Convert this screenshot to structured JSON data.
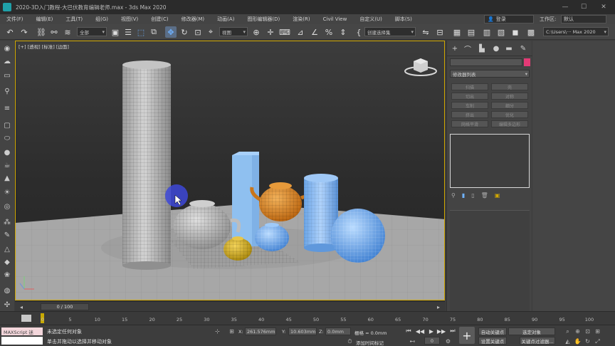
{
  "titlebar": {
    "title": "2020-3D入门教程-大巴伏教育编辑老师.max - 3ds Max 2020",
    "minimize": "—",
    "maximize": "☐",
    "close": "✕"
  },
  "menubar": {
    "items": [
      "文件(F)",
      "编辑(E)",
      "工具(T)",
      "组(G)",
      "视图(V)",
      "创建(C)",
      "修改器(M)",
      "动画(A)",
      "图形编辑器(D)",
      "渲染(R)",
      "Civil View",
      "自定义(U)",
      "脚本(S)"
    ],
    "login": "登录",
    "workspace_label": "工作区:",
    "workspace_value": "默认"
  },
  "toolbar": {
    "selection_filter": "全部",
    "ref_coord": "视图",
    "named_selection": "创建选择集",
    "project_path": "C:\\Users\\··· Max 2020"
  },
  "viewport": {
    "label": "[+] [透视] [标准] [边面]"
  },
  "command_panel": {
    "modifier_list": "修改器列表",
    "buttons": [
      "扫描",
      "壳",
      "切出",
      "对称",
      "车削",
      "细分",
      "挤出",
      "优化",
      "网格平滑",
      "编辑多边形"
    ]
  },
  "timeline": {
    "frame_counter": "0 / 100",
    "ticks": [
      "0",
      "5",
      "10",
      "15",
      "20",
      "25",
      "30",
      "35",
      "40",
      "45",
      "50",
      "55",
      "60",
      "65",
      "70",
      "75",
      "80",
      "85",
      "90",
      "95",
      "100"
    ]
  },
  "statusbar": {
    "maxscript": "MAXScript 迷",
    "msg1": "未选定任何对象",
    "msg2": "单击并拖动以选择并移动对象",
    "x_label": "X:",
    "x_value": "261.576mm",
    "y_label": "Y:",
    "y_value": "10.603mm",
    "z_label": "Z:",
    "z_value": "0.0mm",
    "grid": "栅格 = 0.0mm",
    "add_time_tag": "添加时间标记",
    "auto_key": "自动关键点",
    "set_key": "设置关键点",
    "selected_objects": "选定对象",
    "key_filters": "关键点过滤器...",
    "frame_value": "0"
  },
  "colors": {
    "viewport_border": "#d1a800",
    "object_color": "#e43a76",
    "active_blue": "#6fb2ff"
  }
}
